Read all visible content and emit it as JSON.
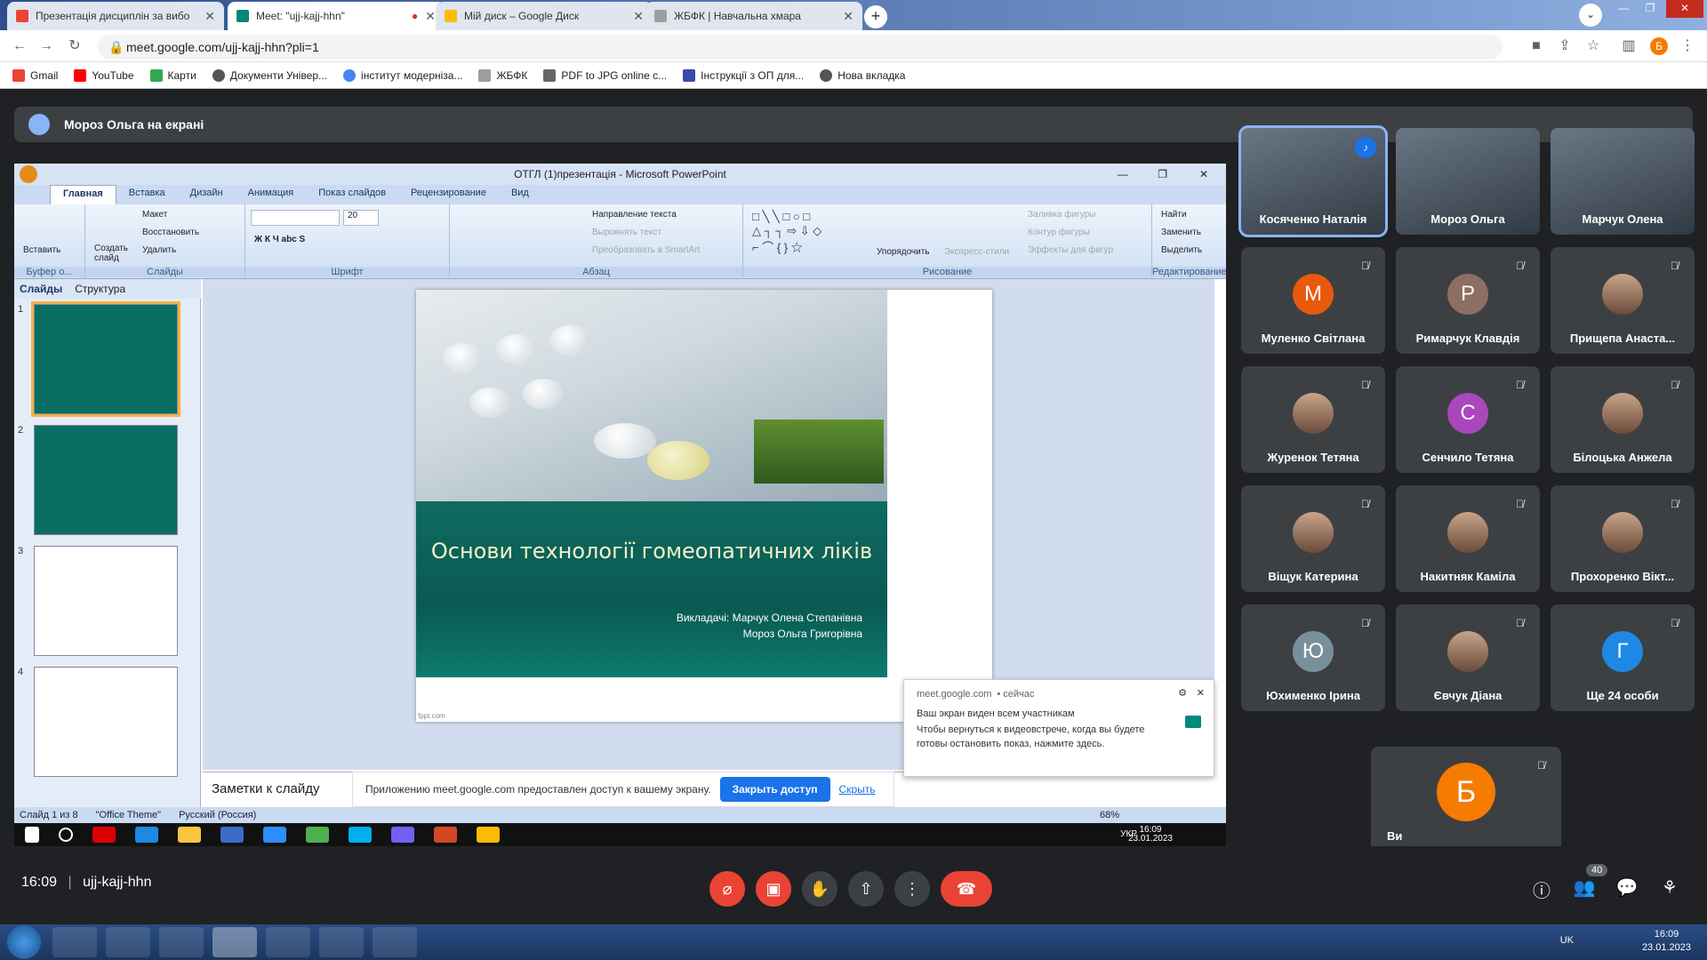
{
  "browser": {
    "tabs": [
      {
        "title": "Презентація дисциплін за вибо",
        "icon": "gmail-icon",
        "color": "#ea4335"
      },
      {
        "title": "Meet: \"ujj-kajj-hhn\"",
        "icon": "meet-icon",
        "color": "#00897b"
      },
      {
        "title": "Мій диск – Google Диск",
        "icon": "drive-icon",
        "color": "#fbbc04"
      },
      {
        "title": "ЖБФК | Навчальна хмара",
        "icon": "cloud-icon",
        "color": "#9e9e9e"
      }
    ],
    "url": "meet.google.com/ujj-kajj-hhn?pli=1",
    "profile_initial": "Б",
    "bookmarks": [
      "Gmail",
      "YouTube",
      "Карти",
      "Документи Універ...",
      "інститут модерніза...",
      "ЖБФК",
      "PDF to JPG online c...",
      "Інструкції з ОП для...",
      "Нова вкладка"
    ]
  },
  "meet": {
    "presenting_label": "Мороз Ольга на екрані",
    "meeting_code": "ujj-kajj-hhn",
    "time": "16:09",
    "people_count": "40",
    "participants": [
      {
        "name": "Косяченко Наталія",
        "type": "video",
        "active": true
      },
      {
        "name": "Мороз Ольга",
        "type": "video"
      },
      {
        "name": "Марчук Олена",
        "type": "video"
      },
      {
        "name": "Муленко Світлана",
        "initial": "М",
        "color": "#e8590c"
      },
      {
        "name": "Римарчук Клавдія",
        "initial": "Р",
        "color": "#8d6e63"
      },
      {
        "name": "Прищепа Анаста...",
        "type": "photo"
      },
      {
        "name": "Журенок Тетяна",
        "type": "photo"
      },
      {
        "name": "Сенчило Тетяна",
        "initial": "С",
        "color": "#ab47bc"
      },
      {
        "name": "Білоцька Анжела",
        "type": "photo"
      },
      {
        "name": "Віщук Катерина",
        "type": "photo"
      },
      {
        "name": "Накитняк Каміла",
        "type": "photo"
      },
      {
        "name": "Прохоренко Вікт...",
        "type": "photo"
      },
      {
        "name": "Юхименко Ірина",
        "initial": "Ю",
        "color": "#78909c"
      },
      {
        "name": "Євчук Діана",
        "type": "photo"
      },
      {
        "name": "Ще 24 особи",
        "initial": "Г",
        "color": "#1e88e5"
      }
    ],
    "self": {
      "name": "Ви",
      "initial": "Б",
      "color": "#f57c00"
    }
  },
  "ppt": {
    "window_title": "ОТГЛ (1)презентація - Microsoft PowerPoint",
    "ribbon_tabs": [
      "Главная",
      "Вставка",
      "Дизайн",
      "Анимация",
      "Показ слайдов",
      "Рецензирование",
      "Вид"
    ],
    "groups": [
      "Буфер о...",
      "Слайды",
      "Шрифт",
      "Абзац",
      "Рисование",
      "Редактирование"
    ],
    "buttons": {
      "paste": "Вставить",
      "new_slide": "Создать слайд",
      "layout": "Макет",
      "reset": "Восстановить",
      "delete": "Удалить",
      "font_size": "20",
      "text_dir": "Направление текста",
      "align_text": "Выровнять текст",
      "smartart": "Преобразовать в SmartArt",
      "arrange": "Упорядочить",
      "quick_styles": "Экспресс-стили",
      "fill": "Заливка фигуры",
      "outline": "Контур фигуры",
      "effects": "Эффекты для фигур",
      "find": "Найти",
      "replace": "Заменить",
      "select": "Выделить"
    },
    "pane_tabs": [
      "Слайды",
      "Структура"
    ],
    "slide_title": "Основи технології гомеопатичних ліків",
    "lecturers_line1": "Викладачі: Марчук Олена Степанівна",
    "lecturers_line2": "Мороз Ольга Григорівна",
    "footer_mark": "fppt.com",
    "notes_placeholder": "Заметки к слайду",
    "status": {
      "slide": "Слайд 1 из 8",
      "theme": "\"Office Theme\"",
      "lang": "Русский (Россия)",
      "zoom": "68%"
    },
    "thumb_numbers": [
      "1",
      "2",
      "3",
      "4"
    ]
  },
  "sharebar": {
    "message": "Приложению meet.google.com предоставлен доступ к вашему экрану.",
    "stop": "Закрыть доступ",
    "hide": "Скрыть"
  },
  "notification": {
    "source": "meet.google.com",
    "when": "• сейчас",
    "title": "Ваш экран виден всем участникам",
    "body": "Чтобы вернуться к видеовстрече, когда вы будете готовы остановить показ, нажмите здесь."
  },
  "inner_taskbar": {
    "lang": "УКР",
    "time": "16:09",
    "date": "23.01.2023"
  },
  "os_taskbar": {
    "lang": "UK",
    "time": "16:09",
    "date": "23.01.2023"
  }
}
